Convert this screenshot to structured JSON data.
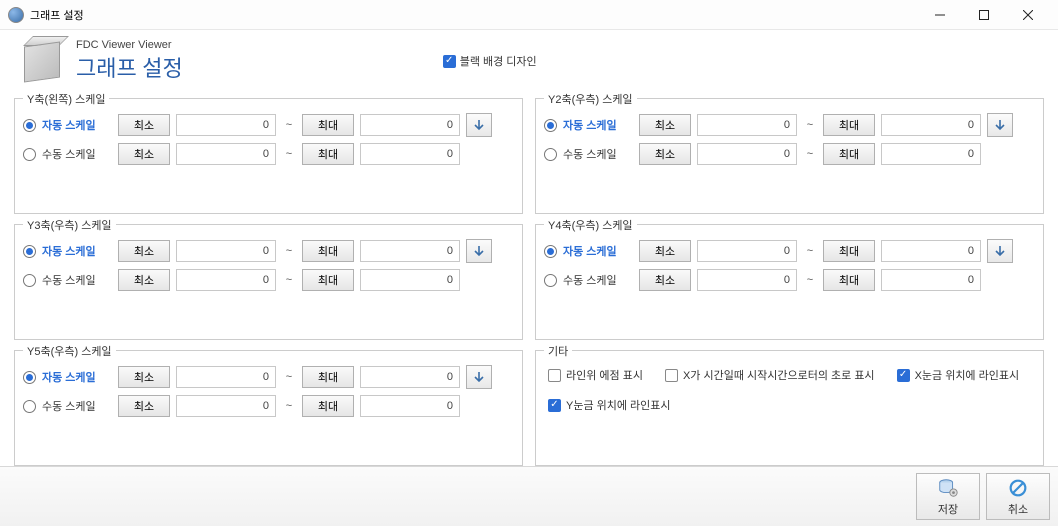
{
  "window": {
    "title": "그래프 설정"
  },
  "header": {
    "small": "FDC Viewer Viewer",
    "large": "그래프 설정",
    "black_bg_design_label": "블랙 배경 디자인",
    "black_bg_design_checked": true
  },
  "axes": [
    {
      "legend": "Y축(왼쪽) 스케일",
      "auto_label": "자동 스케일",
      "manual_label": "수동 스케일",
      "min_label": "최소",
      "max_label": "최대",
      "tilde": "~",
      "auto_min": "0",
      "auto_max": "0",
      "manual_min": "0",
      "manual_max": "0"
    },
    {
      "legend": "Y2축(우측) 스케일",
      "auto_label": "자동 스케일",
      "manual_label": "수동 스케일",
      "min_label": "최소",
      "max_label": "최대",
      "tilde": "~",
      "auto_min": "0",
      "auto_max": "0",
      "manual_min": "0",
      "manual_max": "0"
    },
    {
      "legend": "Y3축(우측) 스케일",
      "auto_label": "자동 스케일",
      "manual_label": "수동 스케일",
      "min_label": "최소",
      "max_label": "최대",
      "tilde": "~",
      "auto_min": "0",
      "auto_max": "0",
      "manual_min": "0",
      "manual_max": "0"
    },
    {
      "legend": "Y4축(우측) 스케일",
      "auto_label": "자동 스케일",
      "manual_label": "수동 스케일",
      "min_label": "최소",
      "max_label": "최대",
      "tilde": "~",
      "auto_min": "0",
      "auto_max": "0",
      "manual_min": "0",
      "manual_max": "0"
    },
    {
      "legend": "Y5축(우측) 스케일",
      "auto_label": "자동 스케일",
      "manual_label": "수동 스케일",
      "min_label": "최소",
      "max_label": "최대",
      "tilde": "~",
      "auto_min": "0",
      "auto_max": "0",
      "manual_min": "0",
      "manual_max": "0"
    }
  ],
  "etc": {
    "legend": "기타",
    "opt1_label": "라인위 에점 표시",
    "opt1_checked": false,
    "opt2_label": "X가 시간일때 시작시간으로터의 초로 표시",
    "opt2_checked": false,
    "opt3_label": "X눈금 위치에 라인표시",
    "opt3_checked": true,
    "opt4_label": "Y눈금 위치에 라인표시",
    "opt4_checked": true
  },
  "footer": {
    "save_label": "저장",
    "cancel_label": "취소"
  }
}
